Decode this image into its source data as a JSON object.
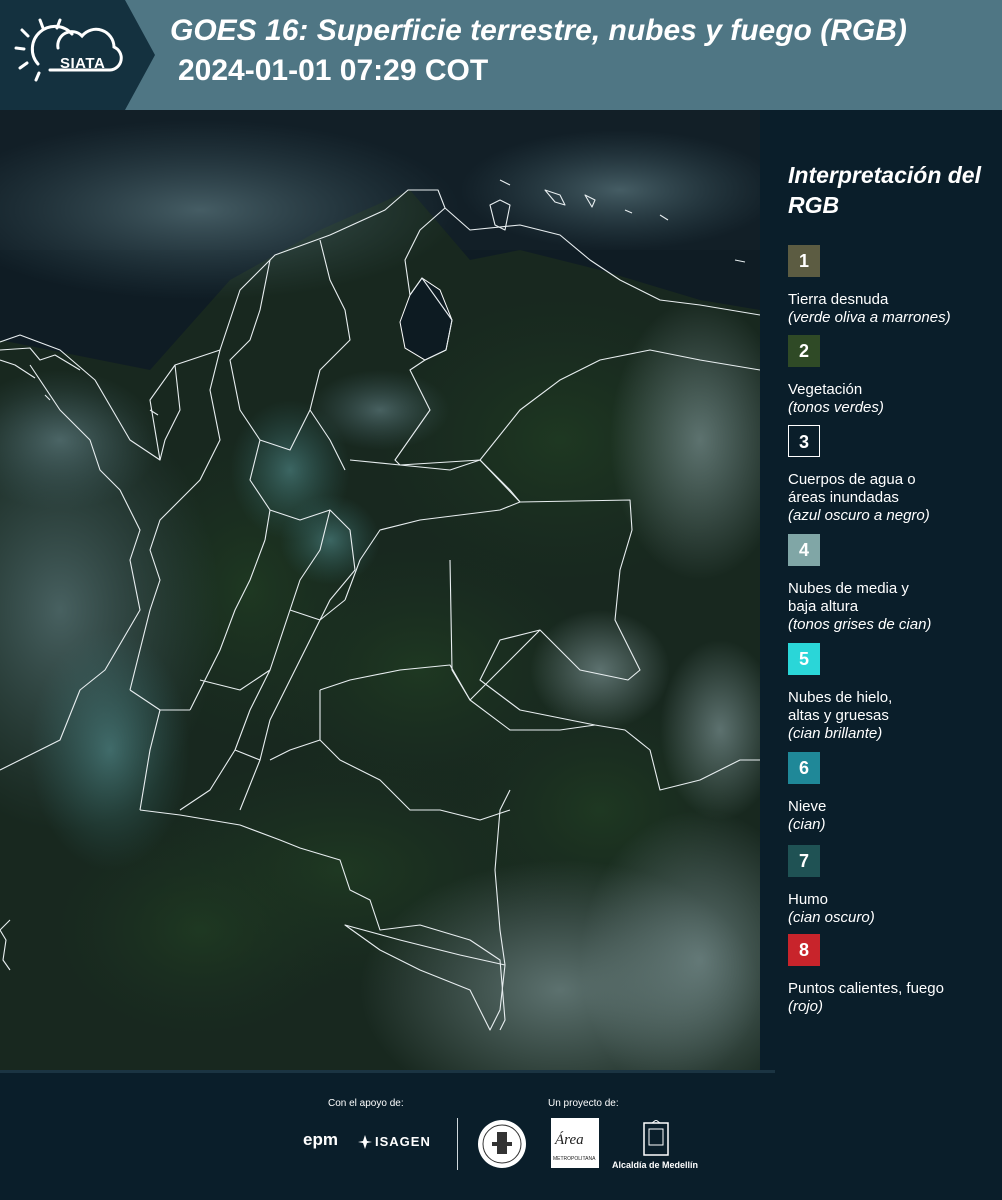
{
  "header": {
    "logo_text": "SIATA",
    "title_line1": "GOES 16: Superficie terrestre, nubes y fuego (RGB)",
    "title_line2": "2024-01-01 07:29 COT"
  },
  "legend": {
    "title": "Interpretación del RGB",
    "items": [
      {
        "number": "1",
        "label": "Tierra desnuda",
        "note": "(verde oliva a marrones)",
        "color": "#5c5c42"
      },
      {
        "number": "2",
        "label": "Vegetación",
        "note": "(tonos verdes)",
        "color": "#2f4a26"
      },
      {
        "number": "3",
        "label": "Cuerpos de agua o\náreas inundadas",
        "note": "(azul oscuro a negro)",
        "color": "#0a1e2a"
      },
      {
        "number": "4",
        "label": "Nubes de media y\nbaja altura",
        "note": "(tonos grises de cian)",
        "color": "#80a6a6"
      },
      {
        "number": "5",
        "label": "Nubes de hielo,\naltas y gruesas",
        "note": "(cian brillante)",
        "color": "#2ad6d8"
      },
      {
        "number": "6",
        "label": "Nieve",
        "note": "(cian)",
        "color": "#1f8898"
      },
      {
        "number": "7",
        "label": "Humo",
        "note": "(cian oscuro)",
        "color": "#1f5254"
      },
      {
        "number": "8",
        "label": "Puntos calientes, fuego",
        "note": "(rojo)",
        "color": "#c8242b"
      }
    ]
  },
  "footer": {
    "support_label": "Con el apoyo de:",
    "project_label": "Un proyecto de:",
    "sponsor_1": "epm",
    "sponsor_2": "ISAGEN",
    "area_logo_text": "Área",
    "area_logo_sub": "METROPOLITANA",
    "alcaldia_label": "Alcaldía de Medellín"
  }
}
